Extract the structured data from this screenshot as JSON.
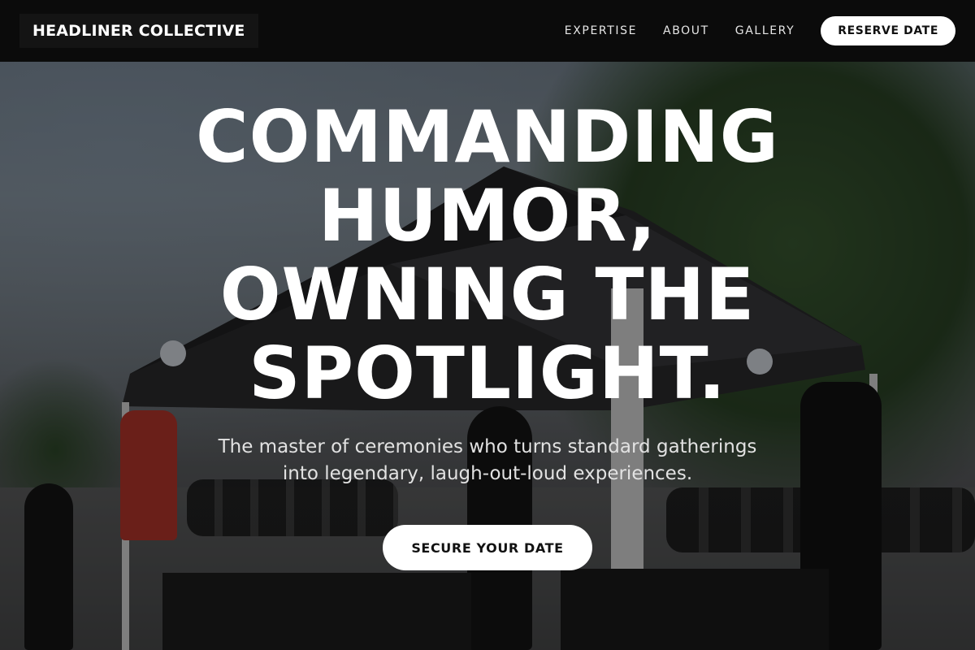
{
  "header": {
    "brand": "HEADLINER COLLECTIVE",
    "nav": [
      {
        "label": "EXPERTISE"
      },
      {
        "label": "ABOUT"
      },
      {
        "label": "GALLERY"
      }
    ],
    "cta_label": "RESERVE DATE"
  },
  "hero": {
    "title": "COMMANDING HUMOR, OWNING THE SPOTLIGHT.",
    "subtitle": "The master of ceremonies who turns standard gatherings into legendary, laugh-out-loud experiences.",
    "cta_label": "SECURE YOUR DATE"
  },
  "colors": {
    "header_bg": "#0b0b0b",
    "button_bg": "#ffffff",
    "button_text": "#111111"
  }
}
